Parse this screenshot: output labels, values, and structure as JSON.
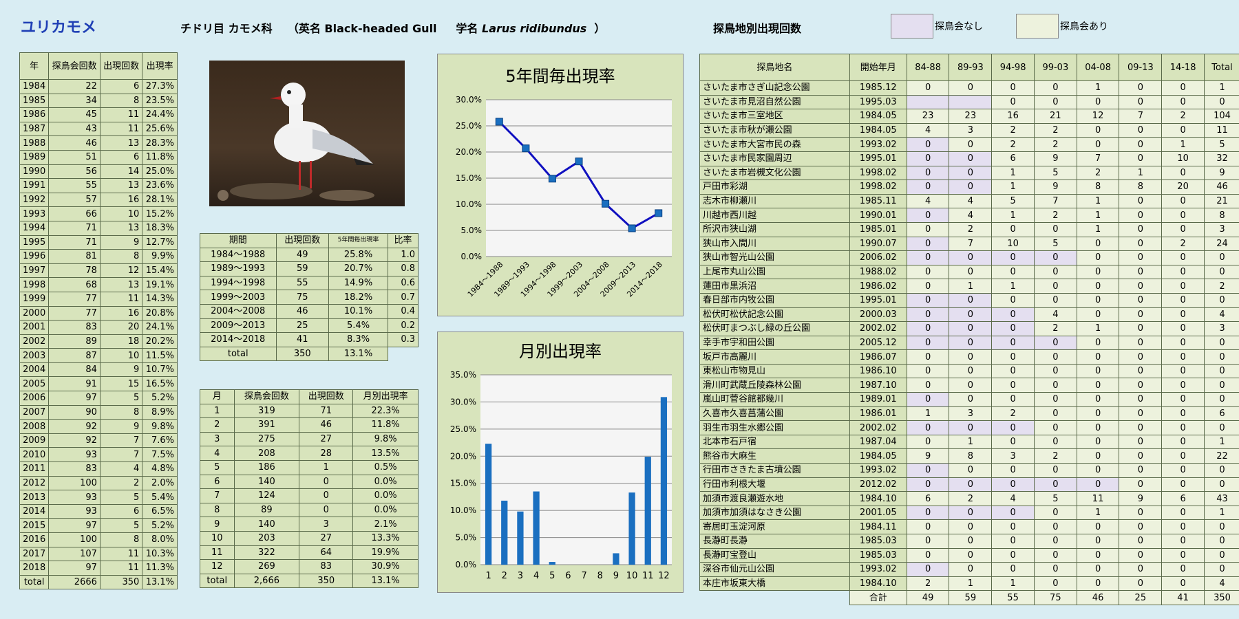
{
  "title": "ユリカモメ",
  "header": {
    "order_family": "チドリ目 カモメ科",
    "english_prefix": "（英名 Black-headed Gull",
    "scientific_prefix": "学名",
    "scientific_name": "Larus ridibundus",
    "scientific_suffix": "）"
  },
  "site_section_title": "探鳥地別出現回数",
  "legend": {
    "no_meeting": {
      "label": "探鳥会なし",
      "color": "#e4dff0"
    },
    "with_meeting": {
      "label": "探鳥会あり",
      "color": "#edf2dd"
    }
  },
  "yearly": {
    "headers": [
      "年",
      "探鳥会回数",
      "出現回数",
      "出現率"
    ],
    "rows": [
      [
        "1984",
        "22",
        "6",
        "27.3%"
      ],
      [
        "1985",
        "34",
        "8",
        "23.5%"
      ],
      [
        "1986",
        "45",
        "11",
        "24.4%"
      ],
      [
        "1987",
        "43",
        "11",
        "25.6%"
      ],
      [
        "1988",
        "46",
        "13",
        "28.3%"
      ],
      [
        "1989",
        "51",
        "6",
        "11.8%"
      ],
      [
        "1990",
        "56",
        "14",
        "25.0%"
      ],
      [
        "1991",
        "55",
        "13",
        "23.6%"
      ],
      [
        "1992",
        "57",
        "16",
        "28.1%"
      ],
      [
        "1993",
        "66",
        "10",
        "15.2%"
      ],
      [
        "1994",
        "71",
        "13",
        "18.3%"
      ],
      [
        "1995",
        "71",
        "9",
        "12.7%"
      ],
      [
        "1996",
        "81",
        "8",
        "9.9%"
      ],
      [
        "1997",
        "78",
        "12",
        "15.4%"
      ],
      [
        "1998",
        "68",
        "13",
        "19.1%"
      ],
      [
        "1999",
        "77",
        "11",
        "14.3%"
      ],
      [
        "2000",
        "77",
        "16",
        "20.8%"
      ],
      [
        "2001",
        "83",
        "20",
        "24.1%"
      ],
      [
        "2002",
        "89",
        "18",
        "20.2%"
      ],
      [
        "2003",
        "87",
        "10",
        "11.5%"
      ],
      [
        "2004",
        "84",
        "9",
        "10.7%"
      ],
      [
        "2005",
        "91",
        "15",
        "16.5%"
      ],
      [
        "2006",
        "97",
        "5",
        "5.2%"
      ],
      [
        "2007",
        "90",
        "8",
        "8.9%"
      ],
      [
        "2008",
        "92",
        "9",
        "9.8%"
      ],
      [
        "2009",
        "92",
        "7",
        "7.6%"
      ],
      [
        "2010",
        "93",
        "7",
        "7.5%"
      ],
      [
        "2011",
        "83",
        "4",
        "4.8%"
      ],
      [
        "2012",
        "100",
        "2",
        "2.0%"
      ],
      [
        "2013",
        "93",
        "5",
        "5.4%"
      ],
      [
        "2014",
        "93",
        "6",
        "6.5%"
      ],
      [
        "2015",
        "97",
        "5",
        "5.2%"
      ],
      [
        "2016",
        "100",
        "8",
        "8.0%"
      ],
      [
        "2017",
        "107",
        "11",
        "10.3%"
      ],
      [
        "2018",
        "97",
        "11",
        "11.3%"
      ],
      [
        "total",
        "2666",
        "350",
        "13.1%"
      ]
    ]
  },
  "period": {
    "headers": [
      "期間",
      "出現回数",
      "5年間毎出現率",
      "比率"
    ],
    "rows": [
      [
        "1984～1988",
        "49",
        "25.8%",
        "1.0"
      ],
      [
        "1989～1993",
        "59",
        "20.7%",
        "0.8"
      ],
      [
        "1994～1998",
        "55",
        "14.9%",
        "0.6"
      ],
      [
        "1999～2003",
        "75",
        "18.2%",
        "0.7"
      ],
      [
        "2004～2008",
        "46",
        "10.1%",
        "0.4"
      ],
      [
        "2009～2013",
        "25",
        "5.4%",
        "0.2"
      ],
      [
        "2014～2018",
        "41",
        "8.3%",
        "0.3"
      ],
      [
        "total",
        "350",
        "13.1%",
        ""
      ]
    ]
  },
  "monthly": {
    "headers": [
      "月",
      "探鳥会回数",
      "出現回数",
      "月別出現率"
    ],
    "rows": [
      [
        "1",
        "319",
        "71",
        "22.3%"
      ],
      [
        "2",
        "391",
        "46",
        "11.8%"
      ],
      [
        "3",
        "275",
        "27",
        "9.8%"
      ],
      [
        "4",
        "208",
        "28",
        "13.5%"
      ],
      [
        "5",
        "186",
        "1",
        "0.5%"
      ],
      [
        "6",
        "140",
        "0",
        "0.0%"
      ],
      [
        "7",
        "124",
        "0",
        "0.0%"
      ],
      [
        "8",
        "89",
        "0",
        "0.0%"
      ],
      [
        "9",
        "140",
        "3",
        "2.1%"
      ],
      [
        "10",
        "203",
        "27",
        "13.3%"
      ],
      [
        "11",
        "322",
        "64",
        "19.9%"
      ],
      [
        "12",
        "269",
        "83",
        "30.9%"
      ],
      [
        "total",
        "2,666",
        "350",
        "13.1%"
      ]
    ]
  },
  "chart_data": [
    {
      "type": "line",
      "title": "5年間毎出現率",
      "categories": [
        "1984～1988",
        "1989～1993",
        "1994～1998",
        "1999～2003",
        "2004～2008",
        "2009～2013",
        "2014～2018"
      ],
      "values": [
        25.8,
        20.7,
        14.9,
        18.2,
        10.1,
        5.4,
        8.3
      ],
      "ylim": [
        0,
        30
      ],
      "yticks": [
        "0.0%",
        "5.0%",
        "10.0%",
        "15.0%",
        "20.0%",
        "25.0%",
        "30.0%"
      ],
      "color": "#1010c0",
      "grid": true
    },
    {
      "type": "bar",
      "title": "月別出現率",
      "categories": [
        "1",
        "2",
        "3",
        "4",
        "5",
        "6",
        "7",
        "8",
        "9",
        "10",
        "11",
        "12"
      ],
      "values": [
        22.3,
        11.8,
        9.8,
        13.5,
        0.5,
        0.0,
        0.0,
        0.0,
        2.1,
        13.3,
        19.9,
        30.9
      ],
      "ylim": [
        0,
        35
      ],
      "yticks": [
        "0.0%",
        "5.0%",
        "10.0%",
        "15.0%",
        "20.0%",
        "25.0%",
        "30.0%",
        "35.0%"
      ],
      "color": "#1a6fc0",
      "grid": true
    }
  ],
  "sites": {
    "headers": [
      "探鳥地名",
      "開始年月",
      "84-88",
      "89-93",
      "94-98",
      "99-03",
      "04-08",
      "09-13",
      "14-18",
      "Total"
    ],
    "rows": [
      {
        "name": "さいたま市さぎ山記念公園",
        "start": "1985.12",
        "v": [
          "0",
          "0",
          "0",
          "0",
          "1",
          "0",
          "0",
          "1"
        ],
        "none": []
      },
      {
        "name": "さいたま市見沼自然公園",
        "start": "1995.03",
        "v": [
          "",
          "",
          "0",
          "0",
          "0",
          "0",
          "0",
          "0"
        ],
        "none": [
          0,
          1
        ]
      },
      {
        "name": "さいたま市三室地区",
        "start": "1984.05",
        "v": [
          "23",
          "23",
          "16",
          "21",
          "12",
          "7",
          "2",
          "104"
        ],
        "none": []
      },
      {
        "name": "さいたま市秋が瀬公園",
        "start": "1984.05",
        "v": [
          "4",
          "3",
          "2",
          "2",
          "0",
          "0",
          "0",
          "11"
        ],
        "none": []
      },
      {
        "name": "さいたま市大宮市民の森",
        "start": "1993.02",
        "v": [
          "0",
          "0",
          "2",
          "2",
          "0",
          "0",
          "1",
          "5"
        ],
        "none": [
          0
        ]
      },
      {
        "name": "さいたま市民家園周辺",
        "start": "1995.01",
        "v": [
          "0",
          "0",
          "6",
          "9",
          "7",
          "0",
          "10",
          "32"
        ],
        "none": [
          0,
          1
        ]
      },
      {
        "name": "さいたま市岩槻文化公園",
        "start": "1998.02",
        "v": [
          "0",
          "0",
          "1",
          "5",
          "2",
          "1",
          "0",
          "9"
        ],
        "none": [
          0,
          1
        ]
      },
      {
        "name": "戸田市彩湖",
        "start": "1998.02",
        "v": [
          "0",
          "0",
          "1",
          "9",
          "8",
          "8",
          "20",
          "46"
        ],
        "none": [
          0,
          1
        ]
      },
      {
        "name": "志木市柳瀬川",
        "start": "1985.11",
        "v": [
          "4",
          "4",
          "5",
          "7",
          "1",
          "0",
          "0",
          "21"
        ],
        "none": []
      },
      {
        "name": "川越市西川越",
        "start": "1990.01",
        "v": [
          "0",
          "4",
          "1",
          "2",
          "1",
          "0",
          "0",
          "8"
        ],
        "none": [
          0
        ]
      },
      {
        "name": "所沢市狭山湖",
        "start": "1985.01",
        "v": [
          "0",
          "2",
          "0",
          "0",
          "1",
          "0",
          "0",
          "3"
        ],
        "none": []
      },
      {
        "name": "狭山市入間川",
        "start": "1990.07",
        "v": [
          "0",
          "7",
          "10",
          "5",
          "0",
          "0",
          "2",
          "24"
        ],
        "none": [
          0
        ]
      },
      {
        "name": "狭山市智光山公園",
        "start": "2006.02",
        "v": [
          "0",
          "0",
          "0",
          "0",
          "0",
          "0",
          "0",
          "0"
        ],
        "none": [
          0,
          1,
          2,
          3
        ]
      },
      {
        "name": "上尾市丸山公園",
        "start": "1988.02",
        "v": [
          "0",
          "0",
          "0",
          "0",
          "0",
          "0",
          "0",
          "0"
        ],
        "none": []
      },
      {
        "name": "蓮田市黒浜沼",
        "start": "1986.02",
        "v": [
          "0",
          "1",
          "1",
          "0",
          "0",
          "0",
          "0",
          "2"
        ],
        "none": []
      },
      {
        "name": "春日部市内牧公園",
        "start": "1995.01",
        "v": [
          "0",
          "0",
          "0",
          "0",
          "0",
          "0",
          "0",
          "0"
        ],
        "none": [
          0,
          1
        ]
      },
      {
        "name": "松伏町松伏記念公園",
        "start": "2000.03",
        "v": [
          "0",
          "0",
          "0",
          "4",
          "0",
          "0",
          "0",
          "4"
        ],
        "none": [
          0,
          1,
          2
        ]
      },
      {
        "name": "松伏町まつぶし緑の丘公園",
        "start": "2002.02",
        "v": [
          "0",
          "0",
          "0",
          "2",
          "1",
          "0",
          "0",
          "3"
        ],
        "none": [
          0,
          1,
          2
        ]
      },
      {
        "name": "幸手市宇和田公園",
        "start": "2005.12",
        "v": [
          "0",
          "0",
          "0",
          "0",
          "0",
          "0",
          "0",
          "0"
        ],
        "none": [
          0,
          1,
          2,
          3
        ]
      },
      {
        "name": "坂戸市高麗川",
        "start": "1986.07",
        "v": [
          "0",
          "0",
          "0",
          "0",
          "0",
          "0",
          "0",
          "0"
        ],
        "none": []
      },
      {
        "name": "東松山市物見山",
        "start": "1986.10",
        "v": [
          "0",
          "0",
          "0",
          "0",
          "0",
          "0",
          "0",
          "0"
        ],
        "none": []
      },
      {
        "name": "滑川町武蔵丘陵森林公園",
        "start": "1987.10",
        "v": [
          "0",
          "0",
          "0",
          "0",
          "0",
          "0",
          "0",
          "0"
        ],
        "none": []
      },
      {
        "name": "嵐山町菅谷館都幾川",
        "start": "1989.01",
        "v": [
          "0",
          "0",
          "0",
          "0",
          "0",
          "0",
          "0",
          "0"
        ],
        "none": [
          0
        ]
      },
      {
        "name": "久喜市久喜菖蒲公園",
        "start": "1986.01",
        "v": [
          "1",
          "3",
          "2",
          "0",
          "0",
          "0",
          "0",
          "6"
        ],
        "none": []
      },
      {
        "name": "羽生市羽生水郷公園",
        "start": "2002.02",
        "v": [
          "0",
          "0",
          "0",
          "0",
          "0",
          "0",
          "0",
          "0"
        ],
        "none": [
          0,
          1,
          2
        ]
      },
      {
        "name": "北本市石戸宿",
        "start": "1987.04",
        "v": [
          "0",
          "1",
          "0",
          "0",
          "0",
          "0",
          "0",
          "1"
        ],
        "none": []
      },
      {
        "name": "熊谷市大麻生",
        "start": "1984.05",
        "v": [
          "9",
          "8",
          "3",
          "2",
          "0",
          "0",
          "0",
          "22"
        ],
        "none": []
      },
      {
        "name": "行田市さきたま古墳公園",
        "start": "1993.02",
        "v": [
          "0",
          "0",
          "0",
          "0",
          "0",
          "0",
          "0",
          "0"
        ],
        "none": [
          0
        ]
      },
      {
        "name": "行田市利根大堰",
        "start": "2012.02",
        "v": [
          "0",
          "0",
          "0",
          "0",
          "0",
          "0",
          "0",
          "0"
        ],
        "none": [
          0,
          1,
          2,
          3,
          4
        ]
      },
      {
        "name": "加須市渡良瀬遊水地",
        "start": "1984.10",
        "v": [
          "6",
          "2",
          "4",
          "5",
          "11",
          "9",
          "6",
          "43"
        ],
        "none": []
      },
      {
        "name": "加須市加須はなさき公園",
        "start": "2001.05",
        "v": [
          "0",
          "0",
          "0",
          "0",
          "1",
          "0",
          "0",
          "1"
        ],
        "none": [
          0,
          1,
          2
        ]
      },
      {
        "name": "寄居町玉淀河原",
        "start": "1984.11",
        "v": [
          "0",
          "0",
          "0",
          "0",
          "0",
          "0",
          "0",
          "0"
        ],
        "none": []
      },
      {
        "name": "長瀞町長瀞",
        "start": "1985.03",
        "v": [
          "0",
          "0",
          "0",
          "0",
          "0",
          "0",
          "0",
          "0"
        ],
        "none": []
      },
      {
        "name": "長瀞町宝登山",
        "start": "1985.03",
        "v": [
          "0",
          "0",
          "0",
          "0",
          "0",
          "0",
          "0",
          "0"
        ],
        "none": []
      },
      {
        "name": "深谷市仙元山公園",
        "start": "1993.02",
        "v": [
          "0",
          "0",
          "0",
          "0",
          "0",
          "0",
          "0",
          "0"
        ],
        "none": [
          0
        ]
      },
      {
        "name": "本庄市坂東大橋",
        "start": "1984.10",
        "v": [
          "2",
          "1",
          "1",
          "0",
          "0",
          "0",
          "0",
          "4"
        ],
        "none": []
      }
    ],
    "total_label": "合計",
    "totals": [
      "49",
      "59",
      "55",
      "75",
      "46",
      "25",
      "41",
      "350"
    ]
  }
}
